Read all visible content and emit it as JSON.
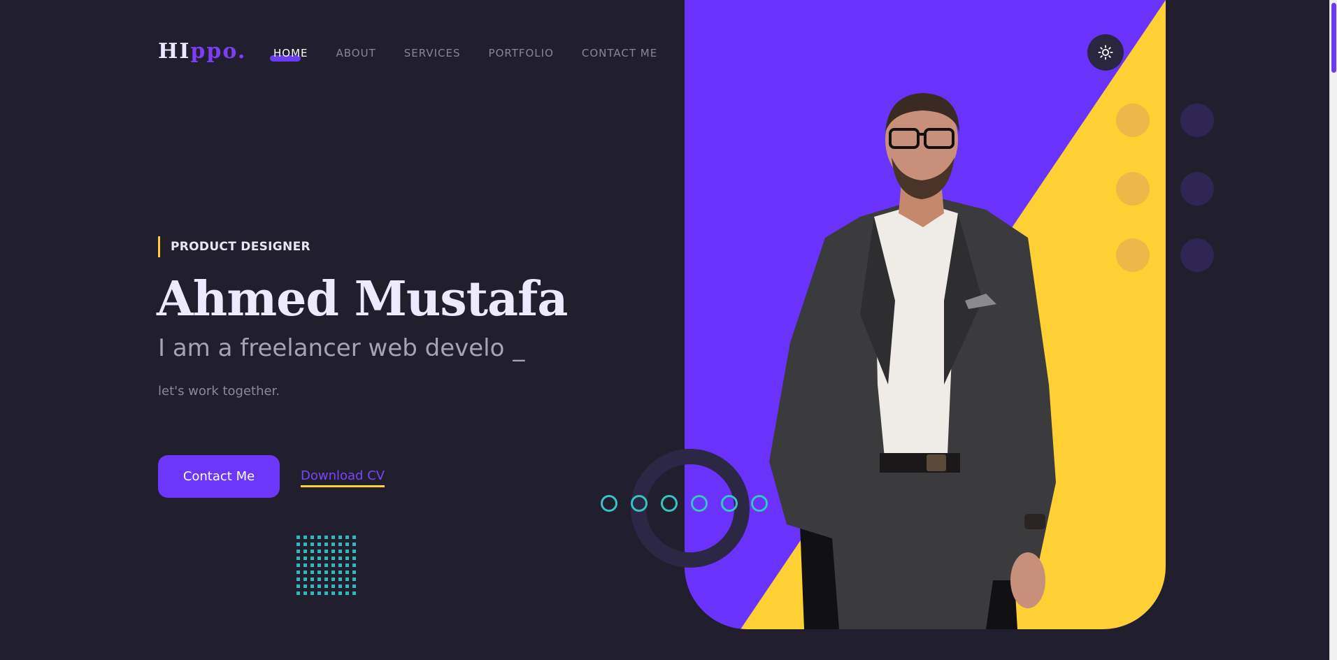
{
  "logo": {
    "part1": "HI",
    "part2": "ppo."
  },
  "nav": {
    "items": [
      {
        "label": "HOME",
        "active": true
      },
      {
        "label": "ABOUT",
        "active": false
      },
      {
        "label": "SERVICES",
        "active": false
      },
      {
        "label": "PORTFOLIO",
        "active": false
      },
      {
        "label": "CONTACT ME",
        "active": false
      }
    ]
  },
  "hero": {
    "badge": "PRODUCT DESIGNER",
    "name": "Ahmed Mustafa",
    "typed_text": "I am a freelancer web develo",
    "typed_cursor": "_",
    "subtitle": "let's work together.",
    "contact_button": "Contact Me",
    "download_link": "Download CV"
  },
  "theme_toggle": {
    "icon": "sun-icon"
  },
  "colors": {
    "background": "#211e2d",
    "accent_purple": "#6c37fa",
    "accent_yellow": "#ffd033",
    "accent_teal": "#36c4c5",
    "text_light": "#ede9ff"
  }
}
